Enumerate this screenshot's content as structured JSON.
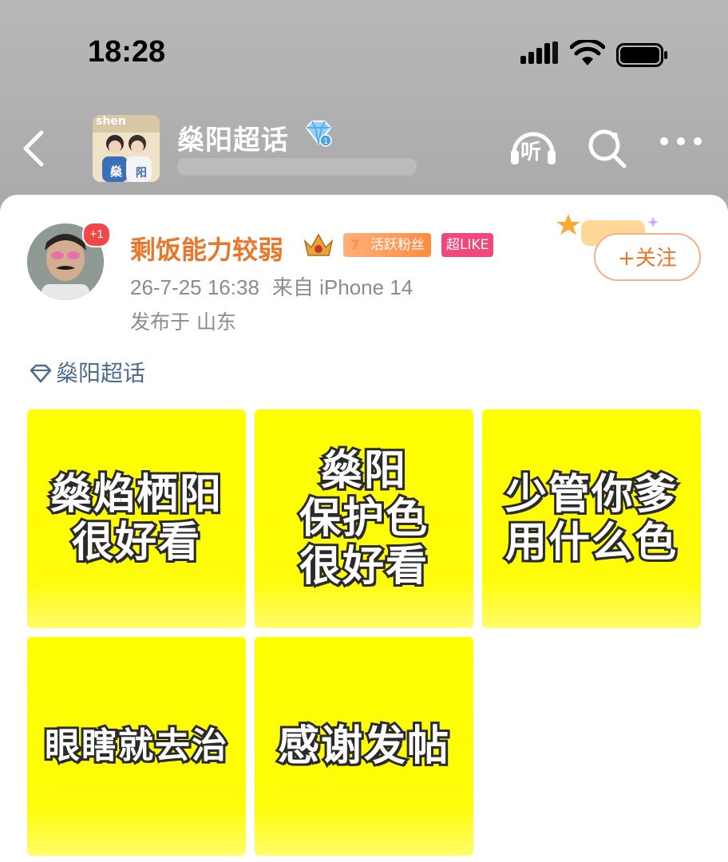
{
  "status_bar": {
    "time": "18:28"
  },
  "header": {
    "title": "燊阳超话",
    "listen_label": "听",
    "cover_text_1": "shen",
    "cover_text_2": "燊",
    "cover_text_3": "阳"
  },
  "post": {
    "author": {
      "name": "剩饭能力较弱",
      "new_badge": "+1",
      "fan_level": "7",
      "fan_badge_label": "活跃粉丝",
      "like_badge_label": "超LIKE"
    },
    "meta": {
      "date": "26-7-25 16:38",
      "source": "来自 iPhone 14",
      "location": "发布于 山东"
    },
    "follow_label": "+关注",
    "topic_label": "燊阳超话",
    "images": [
      {
        "lines": [
          "燊焰栖阳",
          "很好看"
        ]
      },
      {
        "lines": [
          "燊阳",
          "保护色",
          "很好看"
        ]
      },
      {
        "lines": [
          "少管你爹",
          "用什么色"
        ]
      },
      {
        "lines": [
          "眼瞎就去治"
        ]
      },
      {
        "lines": [
          "感谢发帖"
        ]
      }
    ]
  },
  "colors": {
    "accent_orange": "#e8772c",
    "topic_blue": "#4d6b8f",
    "tile_yellow": "#ffff00",
    "like_pink": "#f0487a"
  }
}
